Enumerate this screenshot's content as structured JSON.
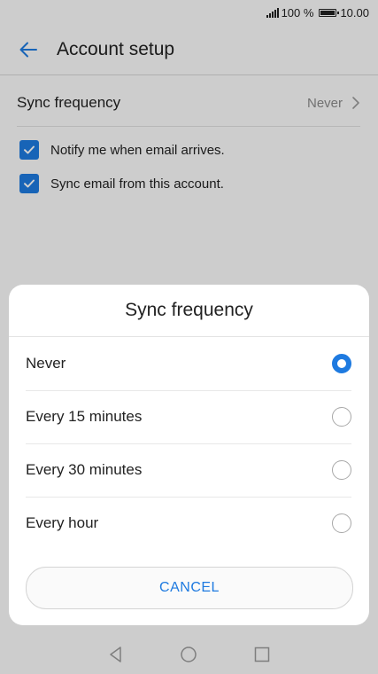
{
  "status_bar": {
    "battery_text": "100 %",
    "time": "10.00"
  },
  "app_bar": {
    "title": "Account setup",
    "back_icon": "arrow-left-icon"
  },
  "settings": {
    "sync_frequency": {
      "label": "Sync frequency",
      "value": "Never"
    },
    "checkboxes": [
      {
        "label": "Notify me when email arrives.",
        "checked": true
      },
      {
        "label": "Sync email from this account.",
        "checked": true
      }
    ]
  },
  "dialog": {
    "title": "Sync frequency",
    "options": [
      {
        "label": "Never",
        "selected": true
      },
      {
        "label": "Every 15 minutes",
        "selected": false
      },
      {
        "label": "Every 30 minutes",
        "selected": false
      },
      {
        "label": "Every hour",
        "selected": false
      }
    ],
    "cancel_label": "CANCEL"
  },
  "colors": {
    "accent": "#1e7ae0"
  }
}
